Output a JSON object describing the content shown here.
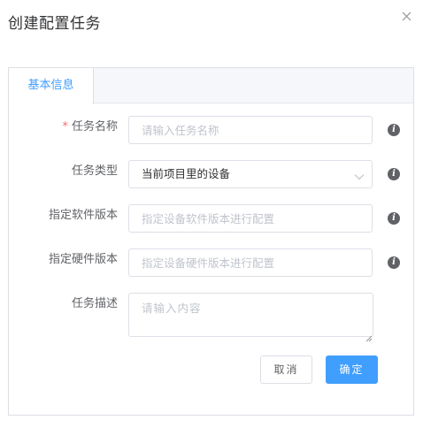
{
  "dialog": {
    "title": "创建配置任务",
    "close_icon": "close-icon"
  },
  "tabs": [
    {
      "label": "基本信息",
      "active": true
    }
  ],
  "form": {
    "task_name": {
      "label": "任务名称",
      "required_mark": "*",
      "placeholder": "请输入任务名称",
      "value": ""
    },
    "task_type": {
      "label": "任务类型",
      "value": "当前项目里的设备",
      "icon": "chevron-down-icon"
    },
    "software_version": {
      "label": "指定软件版本",
      "placeholder": "指定设备软件版本进行配置",
      "value": ""
    },
    "hardware_version": {
      "label": "指定硬件版本",
      "placeholder": "指定设备硬件版本进行配置",
      "value": ""
    },
    "task_desc": {
      "label": "任务描述",
      "placeholder": "请输入内容",
      "value": ""
    },
    "info_icon": "info-icon"
  },
  "buttons": {
    "cancel": "取消",
    "confirm": "确定"
  },
  "colors": {
    "primary": "#409eff",
    "required": "#f56c6c",
    "border": "#dcdfe6",
    "tab_bar_bg": "#f5f7fa"
  }
}
